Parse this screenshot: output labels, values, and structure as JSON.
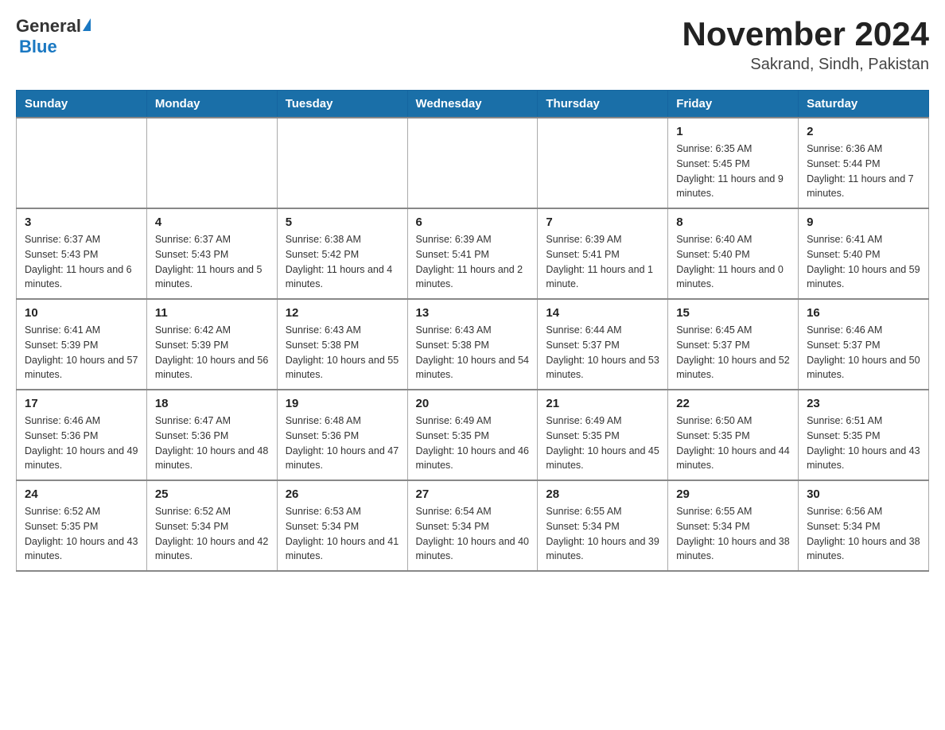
{
  "header": {
    "logo_general": "General",
    "logo_blue": "Blue",
    "month_year": "November 2024",
    "location": "Sakrand, Sindh, Pakistan"
  },
  "weekdays": [
    "Sunday",
    "Monday",
    "Tuesday",
    "Wednesday",
    "Thursday",
    "Friday",
    "Saturday"
  ],
  "weeks": [
    [
      {
        "day": "",
        "info": ""
      },
      {
        "day": "",
        "info": ""
      },
      {
        "day": "",
        "info": ""
      },
      {
        "day": "",
        "info": ""
      },
      {
        "day": "",
        "info": ""
      },
      {
        "day": "1",
        "info": "Sunrise: 6:35 AM\nSunset: 5:45 PM\nDaylight: 11 hours and 9 minutes."
      },
      {
        "day": "2",
        "info": "Sunrise: 6:36 AM\nSunset: 5:44 PM\nDaylight: 11 hours and 7 minutes."
      }
    ],
    [
      {
        "day": "3",
        "info": "Sunrise: 6:37 AM\nSunset: 5:43 PM\nDaylight: 11 hours and 6 minutes."
      },
      {
        "day": "4",
        "info": "Sunrise: 6:37 AM\nSunset: 5:43 PM\nDaylight: 11 hours and 5 minutes."
      },
      {
        "day": "5",
        "info": "Sunrise: 6:38 AM\nSunset: 5:42 PM\nDaylight: 11 hours and 4 minutes."
      },
      {
        "day": "6",
        "info": "Sunrise: 6:39 AM\nSunset: 5:41 PM\nDaylight: 11 hours and 2 minutes."
      },
      {
        "day": "7",
        "info": "Sunrise: 6:39 AM\nSunset: 5:41 PM\nDaylight: 11 hours and 1 minute."
      },
      {
        "day": "8",
        "info": "Sunrise: 6:40 AM\nSunset: 5:40 PM\nDaylight: 11 hours and 0 minutes."
      },
      {
        "day": "9",
        "info": "Sunrise: 6:41 AM\nSunset: 5:40 PM\nDaylight: 10 hours and 59 minutes."
      }
    ],
    [
      {
        "day": "10",
        "info": "Sunrise: 6:41 AM\nSunset: 5:39 PM\nDaylight: 10 hours and 57 minutes."
      },
      {
        "day": "11",
        "info": "Sunrise: 6:42 AM\nSunset: 5:39 PM\nDaylight: 10 hours and 56 minutes."
      },
      {
        "day": "12",
        "info": "Sunrise: 6:43 AM\nSunset: 5:38 PM\nDaylight: 10 hours and 55 minutes."
      },
      {
        "day": "13",
        "info": "Sunrise: 6:43 AM\nSunset: 5:38 PM\nDaylight: 10 hours and 54 minutes."
      },
      {
        "day": "14",
        "info": "Sunrise: 6:44 AM\nSunset: 5:37 PM\nDaylight: 10 hours and 53 minutes."
      },
      {
        "day": "15",
        "info": "Sunrise: 6:45 AM\nSunset: 5:37 PM\nDaylight: 10 hours and 52 minutes."
      },
      {
        "day": "16",
        "info": "Sunrise: 6:46 AM\nSunset: 5:37 PM\nDaylight: 10 hours and 50 minutes."
      }
    ],
    [
      {
        "day": "17",
        "info": "Sunrise: 6:46 AM\nSunset: 5:36 PM\nDaylight: 10 hours and 49 minutes."
      },
      {
        "day": "18",
        "info": "Sunrise: 6:47 AM\nSunset: 5:36 PM\nDaylight: 10 hours and 48 minutes."
      },
      {
        "day": "19",
        "info": "Sunrise: 6:48 AM\nSunset: 5:36 PM\nDaylight: 10 hours and 47 minutes."
      },
      {
        "day": "20",
        "info": "Sunrise: 6:49 AM\nSunset: 5:35 PM\nDaylight: 10 hours and 46 minutes."
      },
      {
        "day": "21",
        "info": "Sunrise: 6:49 AM\nSunset: 5:35 PM\nDaylight: 10 hours and 45 minutes."
      },
      {
        "day": "22",
        "info": "Sunrise: 6:50 AM\nSunset: 5:35 PM\nDaylight: 10 hours and 44 minutes."
      },
      {
        "day": "23",
        "info": "Sunrise: 6:51 AM\nSunset: 5:35 PM\nDaylight: 10 hours and 43 minutes."
      }
    ],
    [
      {
        "day": "24",
        "info": "Sunrise: 6:52 AM\nSunset: 5:35 PM\nDaylight: 10 hours and 43 minutes."
      },
      {
        "day": "25",
        "info": "Sunrise: 6:52 AM\nSunset: 5:34 PM\nDaylight: 10 hours and 42 minutes."
      },
      {
        "day": "26",
        "info": "Sunrise: 6:53 AM\nSunset: 5:34 PM\nDaylight: 10 hours and 41 minutes."
      },
      {
        "day": "27",
        "info": "Sunrise: 6:54 AM\nSunset: 5:34 PM\nDaylight: 10 hours and 40 minutes."
      },
      {
        "day": "28",
        "info": "Sunrise: 6:55 AM\nSunset: 5:34 PM\nDaylight: 10 hours and 39 minutes."
      },
      {
        "day": "29",
        "info": "Sunrise: 6:55 AM\nSunset: 5:34 PM\nDaylight: 10 hours and 38 minutes."
      },
      {
        "day": "30",
        "info": "Sunrise: 6:56 AM\nSunset: 5:34 PM\nDaylight: 10 hours and 38 minutes."
      }
    ]
  ]
}
